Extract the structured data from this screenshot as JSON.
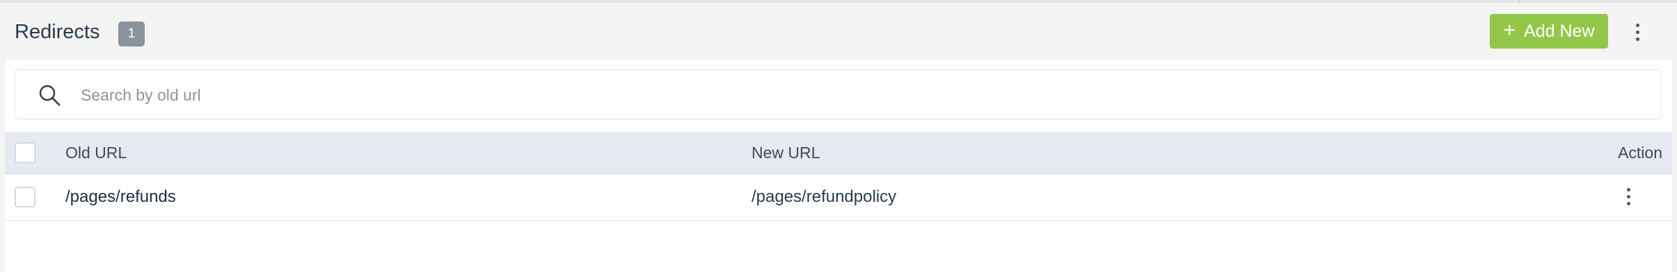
{
  "header": {
    "title": "Redirects",
    "count": "1",
    "add_new_label": "Add New",
    "add_new_icon": "plus-icon",
    "more_icon": "vertical-dots-icon"
  },
  "search": {
    "placeholder": "Search by old url",
    "value": "",
    "icon": "search-icon"
  },
  "table": {
    "columns": [
      "Old URL",
      "New URL",
      "Action"
    ],
    "rows": [
      {
        "old_url": "/pages/refunds",
        "new_url": "/pages/refundpolicy",
        "action_icon": "vertical-dots-icon"
      }
    ]
  },
  "colors": {
    "accent": "#93c74a",
    "badge": "#8a939c",
    "table_header_bg": "#e6e9f0",
    "page_bg": "#f4f4f4"
  }
}
